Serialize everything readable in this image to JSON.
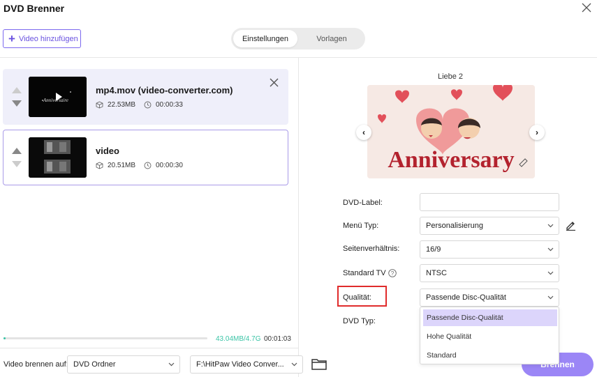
{
  "window": {
    "title": "DVD Brenner",
    "close_icon": "close-icon"
  },
  "toolbar": {
    "add_video_label": "Video hinzufügen"
  },
  "tabs": {
    "settings": "Einstellungen",
    "templates": "Vorlagen",
    "active": "Einstellungen"
  },
  "videos": [
    {
      "name": "mp4.mov (video-converter.com)",
      "size": "22.53MB",
      "duration": "00:00:33",
      "thumb_text": "Anniversaire"
    },
    {
      "name": "video",
      "size": "20.51MB",
      "duration": "00:00:30"
    }
  ],
  "progress": {
    "used": "43.04MB/4.7G",
    "time": "00:01:03",
    "fraction": 0.01
  },
  "bottom": {
    "burn_to_label": "Video brennen auf:",
    "target_value": "DVD Ordner",
    "path_value": "F:\\HitPaw Video Conver...",
    "burn_button": "Brennen"
  },
  "preview": {
    "template_name": "Liebe 2",
    "banner_text": "Anniversary"
  },
  "form": {
    "dvd_label": {
      "label": "DVD-Label:",
      "value": ""
    },
    "menu_type": {
      "label": "Menü Typ:",
      "value": "Personalisierung"
    },
    "aspect_ratio": {
      "label": "Seitenverhältnis:",
      "value": "16/9"
    },
    "standard_tv": {
      "label": "Standard TV",
      "value": "NTSC"
    },
    "quality": {
      "label": "Qualität:",
      "value": "Passende Disc-Qualität"
    },
    "dvd_type": {
      "label": "DVD Typ:"
    }
  },
  "quality_dropdown": {
    "options": [
      "Passende Disc-Qualität",
      "Hohe Qualität",
      "Standard"
    ],
    "selected": "Passende Disc-Qualität"
  },
  "colors": {
    "accent": "#7b68ee",
    "burn_button": "#9b86f6",
    "progress": "#3bc4a6",
    "highlight": "#e02b2b"
  }
}
